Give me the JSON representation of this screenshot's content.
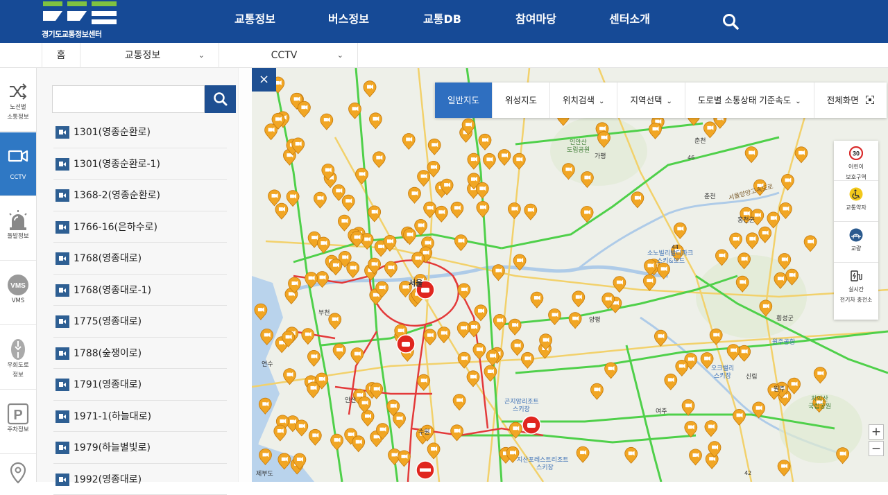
{
  "header": {
    "logo_text": "경기도교통정보센터",
    "nav": [
      "교통정보",
      "버스정보",
      "교통DB",
      "참여마당",
      "센터소개"
    ],
    "search_icon": "search-icon"
  },
  "breadcrumb": {
    "home": "홈",
    "level1": "교통정보",
    "level2": "CCTV"
  },
  "rail": {
    "items": [
      {
        "label1": "노선별",
        "label2": "소통정보",
        "icon": "shuffle-icon"
      },
      {
        "label1": "CCTV",
        "label2": "",
        "icon": "video-camera-icon"
      },
      {
        "label1": "돌발정보",
        "label2": "",
        "icon": "siren-icon"
      },
      {
        "label1": "VMS",
        "label2": "",
        "icon": "vms-icon"
      },
      {
        "label1": "우회도로",
        "label2": "정보",
        "icon": "detour-icon"
      },
      {
        "label1": "주차정보",
        "label2": "",
        "icon": "parking-icon"
      }
    ]
  },
  "search": {
    "value": "",
    "placeholder": ""
  },
  "cctv_list": [
    "1301(영종순환로)",
    "1301(영종순환로-1)",
    "1368-2(영종순환로)",
    "1766-16(은하수로)",
    "1768(영종대로)",
    "1768(영종대로-1)",
    "1775(영종대로)",
    "1788(숲쟁이로)",
    "1791(영종대로)",
    "1971-1(하늘대로)",
    "1979(하늘별빛로)",
    "1992(영종대로)"
  ],
  "map": {
    "close_label": "×",
    "toolbar": {
      "normal": "일반지도",
      "satellite": "위성지도",
      "location": "위치검색",
      "region": "지역선택",
      "speed": "도로별 소통상태 기준속도",
      "fullscreen": "전체화면"
    },
    "layers": [
      {
        "label1": "어린이",
        "label2": "보호구역",
        "icon": "school-zone-30-icon"
      },
      {
        "label1": "교통약자",
        "label2": "",
        "icon": "wheelchair-icon"
      },
      {
        "label1": "교량",
        "label2": "",
        "icon": "bridge-icon"
      },
      {
        "label1": "실시간",
        "label2": "전기차 충전소",
        "icon": "ev-charger-icon"
      }
    ],
    "zoom_in": "+",
    "zoom_out": "−",
    "labels": {
      "chuncheon": "춘천",
      "chuncheon2": "춘천",
      "hongcheon": "홍천군",
      "seoul": "서울",
      "bucheon": "부천",
      "suwon": "수원",
      "yangpyeong": "양평",
      "wonju": "원주",
      "yeoju": "여주",
      "hoengseong": "횡성군",
      "ansan": "안산",
      "sinrim": "신림",
      "wonju_airport": "원주공항",
      "chiaksan": "치악산",
      "chiaksan2": "국립공원",
      "oak_valley": "오크밸리",
      "oak_valley2": "스키장",
      "sono1": "소노빌리발디파크",
      "sono2": "스키&보드",
      "inan1": "인안산",
      "inan2": "도립공원",
      "gonjiam1": "곤지암리조트",
      "gonjiam2": "스키장",
      "jisan1": "지산포레스트리조트",
      "jisan2": "스키장",
      "expressway": "서울양양고속도로",
      "gapyeong": "가평",
      "jebudo": "제부도",
      "yeonsu": "연수",
      "route46": "46",
      "route44": "44",
      "route42": "42"
    }
  }
}
